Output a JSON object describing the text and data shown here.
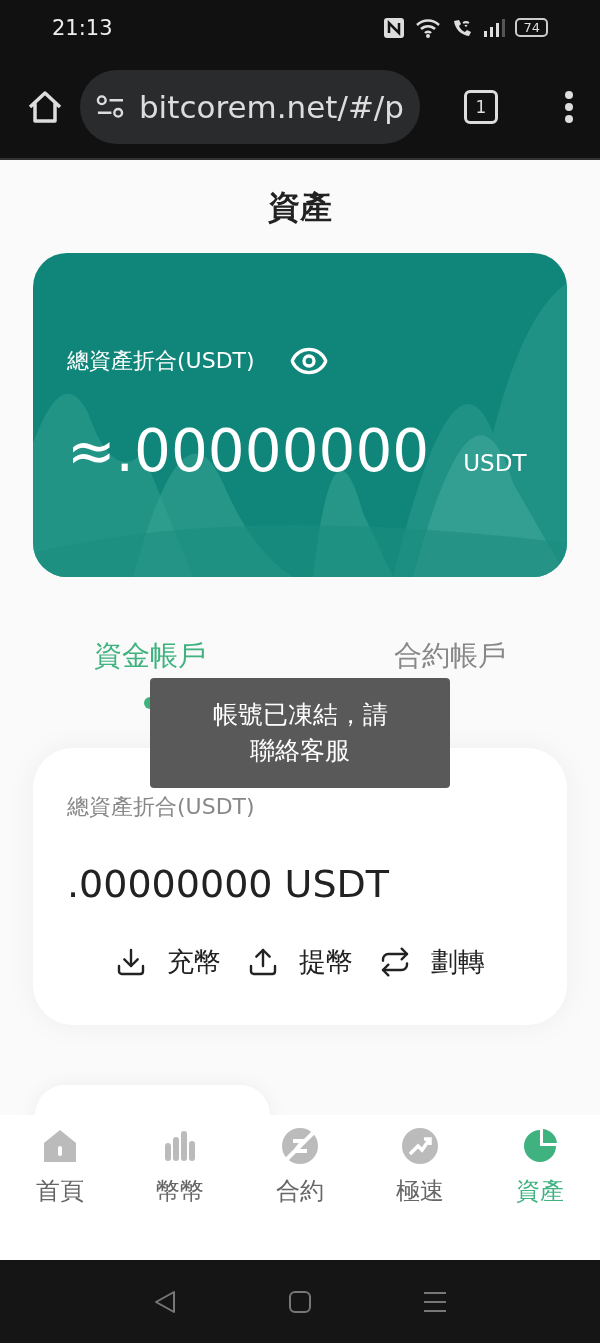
{
  "status_bar": {
    "time": "21:13",
    "battery": "74"
  },
  "browser": {
    "url": "bitcorem.net/#/p",
    "tab_count": "1"
  },
  "page_title": "資產",
  "balance_card": {
    "label": "總資產折合(USDT)",
    "amount": "≈.00000000",
    "unit": "USDT"
  },
  "account_tabs": [
    {
      "label": "資金帳戶",
      "selected": true
    },
    {
      "label": "合約帳戶",
      "selected": false
    }
  ],
  "toast": "帳號已凍結，請聯絡客服",
  "account_card": {
    "label": "總資產折合(USDT)",
    "amount": ".00000000 USDT",
    "actions": [
      {
        "kind": "deposit",
        "label": "充幣"
      },
      {
        "kind": "withdraw",
        "label": "提幣"
      },
      {
        "kind": "transfer",
        "label": "劃轉"
      }
    ]
  },
  "bottom_nav": [
    {
      "kind": "home",
      "label": "首頁",
      "selected": false
    },
    {
      "kind": "market",
      "label": "幣幣",
      "selected": false
    },
    {
      "kind": "contract",
      "label": "合約",
      "selected": false
    },
    {
      "kind": "speed",
      "label": "極速",
      "selected": false
    },
    {
      "kind": "assets",
      "label": "資產",
      "selected": true
    }
  ]
}
